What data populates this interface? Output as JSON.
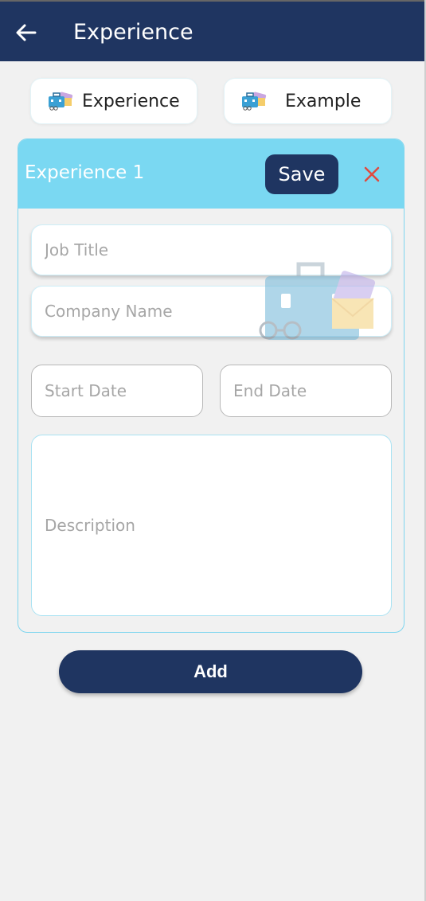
{
  "app_bar": {
    "title": "Experience",
    "back_icon": "arrow-left-icon"
  },
  "tabs": [
    {
      "label": "Experience",
      "icon": "briefcase-icon"
    },
    {
      "label": "Example",
      "icon": "briefcase-icon"
    }
  ],
  "card": {
    "title": "Experience 1",
    "save_label": "Save",
    "close_icon": "close-icon",
    "fields": {
      "job_title": {
        "placeholder": "Job Title",
        "value": ""
      },
      "company_name": {
        "placeholder": "Company Name",
        "value": ""
      },
      "start_date": {
        "placeholder": "Start Date",
        "value": ""
      },
      "end_date": {
        "placeholder": "End Date",
        "value": ""
      },
      "description": {
        "placeholder": "Description",
        "value": ""
      }
    }
  },
  "add_label": "Add",
  "colors": {
    "primary": "#1f3561",
    "card_header": "#7ad8f2",
    "close": "#e04a3f",
    "background": "#f1f1f1"
  }
}
